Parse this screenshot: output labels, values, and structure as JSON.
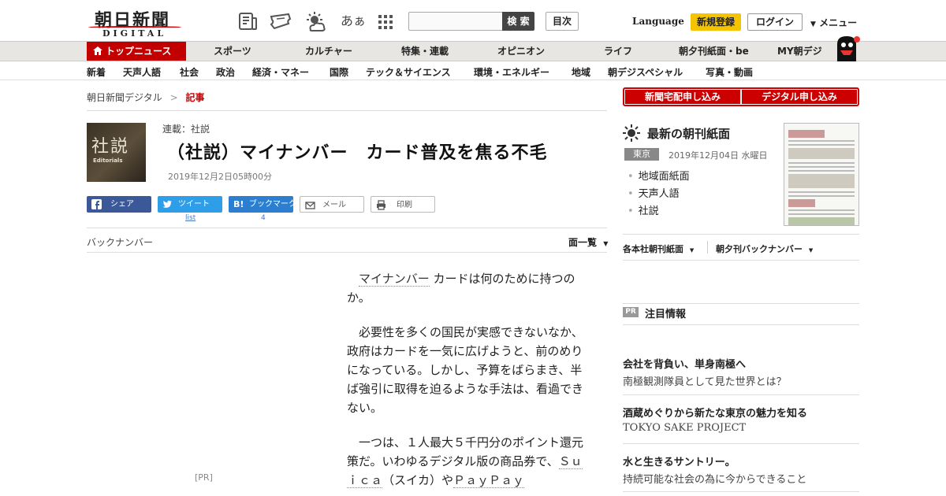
{
  "header": {
    "logo_jp": "朝日新聞",
    "logo_en": "DIGITAL",
    "icons": [
      "newspaper-icon",
      "ticket-icon",
      "weather-icon",
      "font-size-icon",
      "apps-grid-icon"
    ],
    "font_size_label": "あぁ",
    "search_placeholder": "",
    "search_button": "検 索",
    "toc_button": "目次",
    "language": "Language",
    "register": "新規登録",
    "login": "ログイン",
    "menu": "メニュー"
  },
  "nav_main": [
    "トップニュース",
    "スポーツ",
    "カルチャー",
    "特集・連載",
    "オピニオン",
    "ライフ",
    "朝夕刊紙面・be",
    "MY朝デジ"
  ],
  "nav_sub": [
    "新着",
    "天声人語",
    "社会",
    "政治",
    "経済・マネー",
    "国際",
    "テック＆サイエンス",
    "環境・エネルギー",
    "地域",
    "朝デジスペシャル",
    "写真・動画"
  ],
  "breadcrumb": {
    "home": "朝日新聞デジタル",
    "sep": ">",
    "current": "記事"
  },
  "article": {
    "thumb_kanji": "社説",
    "thumb_en": "Editorials",
    "series": "連載：社説",
    "title": "（社説）マイナンバー　カード普及を焦る不毛",
    "date": "2019年12月2日05時00分"
  },
  "share": {
    "facebook": "シェア",
    "twitter": "ツイート",
    "twitter_count": "list",
    "hatena": "ブックマーク",
    "hatena_count": "4",
    "mail": "メール",
    "print": "印刷"
  },
  "backnumber": {
    "label": "バックナンバー",
    "page_list": "面一覧"
  },
  "pr_left": "[PR]",
  "body": {
    "p1_link": "マイナンバー",
    "p1_rest": "カードは何のために持つのか。",
    "p2": "必要性を多くの国民が実感できないなか、政府はカードを一気に広げようと、前のめりになっている。しかし、予算をばらまき、半ば強引に取得を迫るような手法は、看過できない。",
    "p3_a": "一つは、１人最大５千円分のポイント還元策だ。いわゆるデジタル版の商品券で、",
    "p3_link1": "Ｓｕｉｃａ",
    "p3_b": "（スイカ）や",
    "p3_link2": "ＰａｙＰａｙ"
  },
  "sidebar": {
    "apply_paper": "新聞宅配申し込み",
    "apply_digital": "デジタル申し込み",
    "paper_heading": "最新の朝刊紙面",
    "region": "東京",
    "paper_date": "2019年12月04日 水曜日",
    "paper_links": [
      "地域面紙面",
      "天声人語",
      "社説"
    ],
    "dropdown1": "各本社朝刊紙面",
    "dropdown2": "朝夕刊バックナンバー",
    "pr_badge": "PR",
    "pr_heading": "注目情報",
    "pr_items": [
      {
        "title": "会社を背負い、単身南極へ",
        "sub": "南極観測隊員として見た世界とは？"
      },
      {
        "title": "酒蔵めぐりから新たな東京の魅力を知る",
        "sub": "TOKYO SAKE PROJECT"
      },
      {
        "title": "水と生きるサントリー。",
        "sub": "持続可能な社会の為に今からできること"
      }
    ]
  },
  "colors": {
    "brand_red": "#c20000",
    "nav_bg": "#e8e6e3",
    "register_yellow": "#f5c400"
  }
}
